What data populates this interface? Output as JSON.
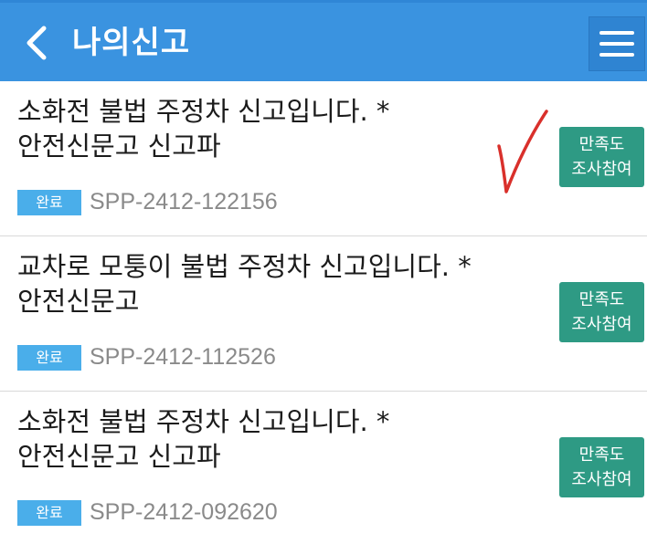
{
  "header": {
    "title": "나의신고",
    "back_icon": "chevron-left-icon",
    "menu_icon": "hamburger-menu-icon",
    "color": "#3a93e0"
  },
  "reports": [
    {
      "title": "소화전 불법 주정차 신고입니다. * 안전신문고 신고파",
      "status": "완료",
      "number": "SPP-2412-122156",
      "survey_line1": "만족도",
      "survey_line2": "조사참여"
    },
    {
      "title": "교차로 모퉁이 불법 주정차 신고입니다. * 안전신문고",
      "status": "완료",
      "number": "SPP-2412-112526",
      "survey_line1": "만족도",
      "survey_line2": "조사참여"
    },
    {
      "title": "소화전 불법 주정차 신고입니다. * 안전신문고 신고파",
      "status": "완료",
      "number": "SPP-2412-092620",
      "survey_line1": "만족도",
      "survey_line2": "조사참여"
    }
  ],
  "colors": {
    "status_badge": "#4aaeea",
    "survey_button": "#2e9a84",
    "check_mark": "#d9302b"
  }
}
